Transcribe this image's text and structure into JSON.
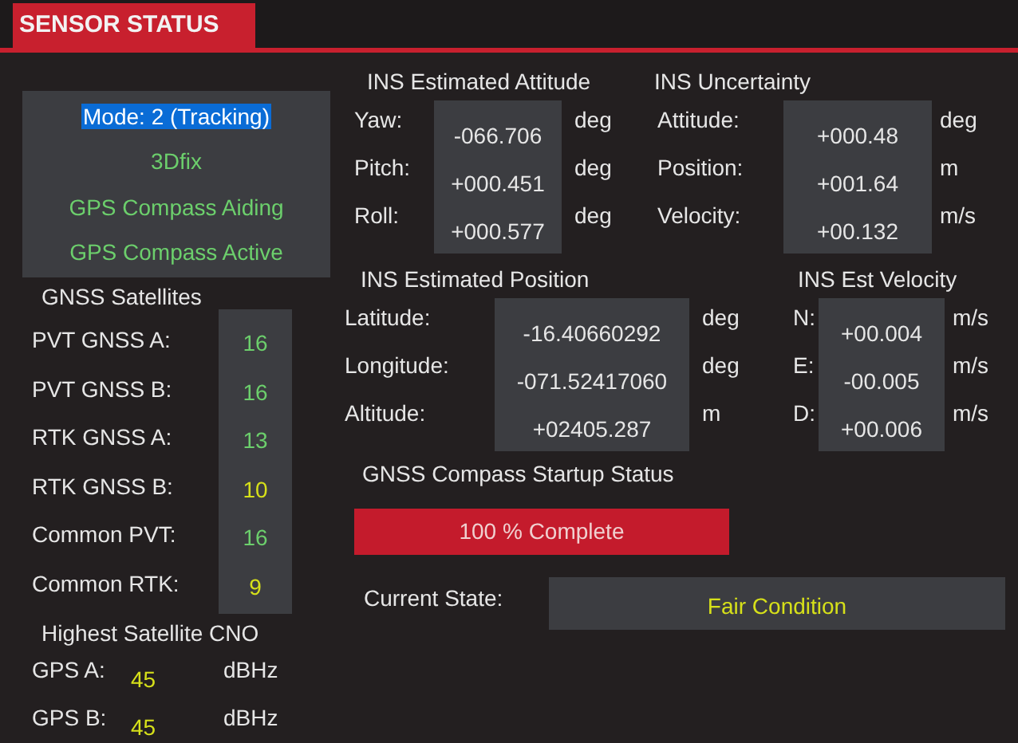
{
  "tab": {
    "label": "SENSOR STATUS",
    "selected": true
  },
  "mode_box": {
    "mode": {
      "text": "Mode: 2 (Tracking)",
      "selected": true
    },
    "lines": [
      {
        "text": "3Dfix",
        "color": "#6ccf6c"
      },
      {
        "text": "GPS Compass Aiding",
        "color": "#6ccf6c"
      },
      {
        "text": "GPS Compass Active",
        "color": "#6ccf6c"
      }
    ]
  },
  "gnss_satellites": {
    "title": "GNSS Satellites",
    "rows": [
      {
        "label": "PVT GNSS A:",
        "value": "16",
        "color": "#6ccf6c"
      },
      {
        "label": "PVT GNSS B:",
        "value": "16",
        "color": "#6ccf6c"
      },
      {
        "label": "RTK GNSS A:",
        "value": "13",
        "color": "#6ccf6c"
      },
      {
        "label": "RTK GNSS B:",
        "value": "10",
        "color": "#d6e01a"
      },
      {
        "label": "Common PVT:",
        "value": "16",
        "color": "#6ccf6c"
      },
      {
        "label": "Common RTK:",
        "value": "9",
        "color": "#d6e01a"
      }
    ]
  },
  "highest_cno": {
    "title": "Highest Satellite CNO",
    "rows": [
      {
        "label": "GPS A:",
        "value": "45",
        "unit": "dBHz",
        "color": "#d6e01a"
      },
      {
        "label": "GPS B:",
        "value": "45",
        "unit": "dBHz",
        "color": "#d6e01a"
      }
    ]
  },
  "ins_attitude": {
    "title": "INS Estimated Attitude",
    "rows": [
      {
        "label": "Yaw:",
        "value": "-066.706",
        "unit": "deg"
      },
      {
        "label": "Pitch:",
        "value": "+000.451",
        "unit": "deg"
      },
      {
        "label": "Roll:",
        "value": "+000.577",
        "unit": "deg"
      }
    ]
  },
  "ins_uncertainty": {
    "title": "INS Uncertainty",
    "rows": [
      {
        "label": "Attitude:",
        "value": "+000.48",
        "unit": "deg"
      },
      {
        "label": "Position:",
        "value": "+001.64",
        "unit": "m"
      },
      {
        "label": "Velocity:",
        "value": "+00.132",
        "unit": "m/s"
      }
    ]
  },
  "ins_position": {
    "title": "INS Estimated Position",
    "rows": [
      {
        "label": "Latitude:",
        "value": "-16.40660292",
        "unit": "deg"
      },
      {
        "label": "Longitude:",
        "value": "-071.52417060",
        "unit": "deg"
      },
      {
        "label": "Altitude:",
        "value": "+02405.287",
        "unit": "m"
      }
    ]
  },
  "ins_velocity": {
    "title": "INS Est Velocity",
    "rows": [
      {
        "label": "N:",
        "value": "+00.004",
        "unit": "m/s"
      },
      {
        "label": "E:",
        "value": "-00.005",
        "unit": "m/s"
      },
      {
        "label": "D:",
        "value": "+00.006",
        "unit": "m/s"
      }
    ]
  },
  "startup_status": {
    "title": "GNSS Compass Startup Status",
    "progress": {
      "text": "100 % Complete"
    }
  },
  "current_state": {
    "label": "Current State:",
    "value": "Fair Condition"
  }
}
